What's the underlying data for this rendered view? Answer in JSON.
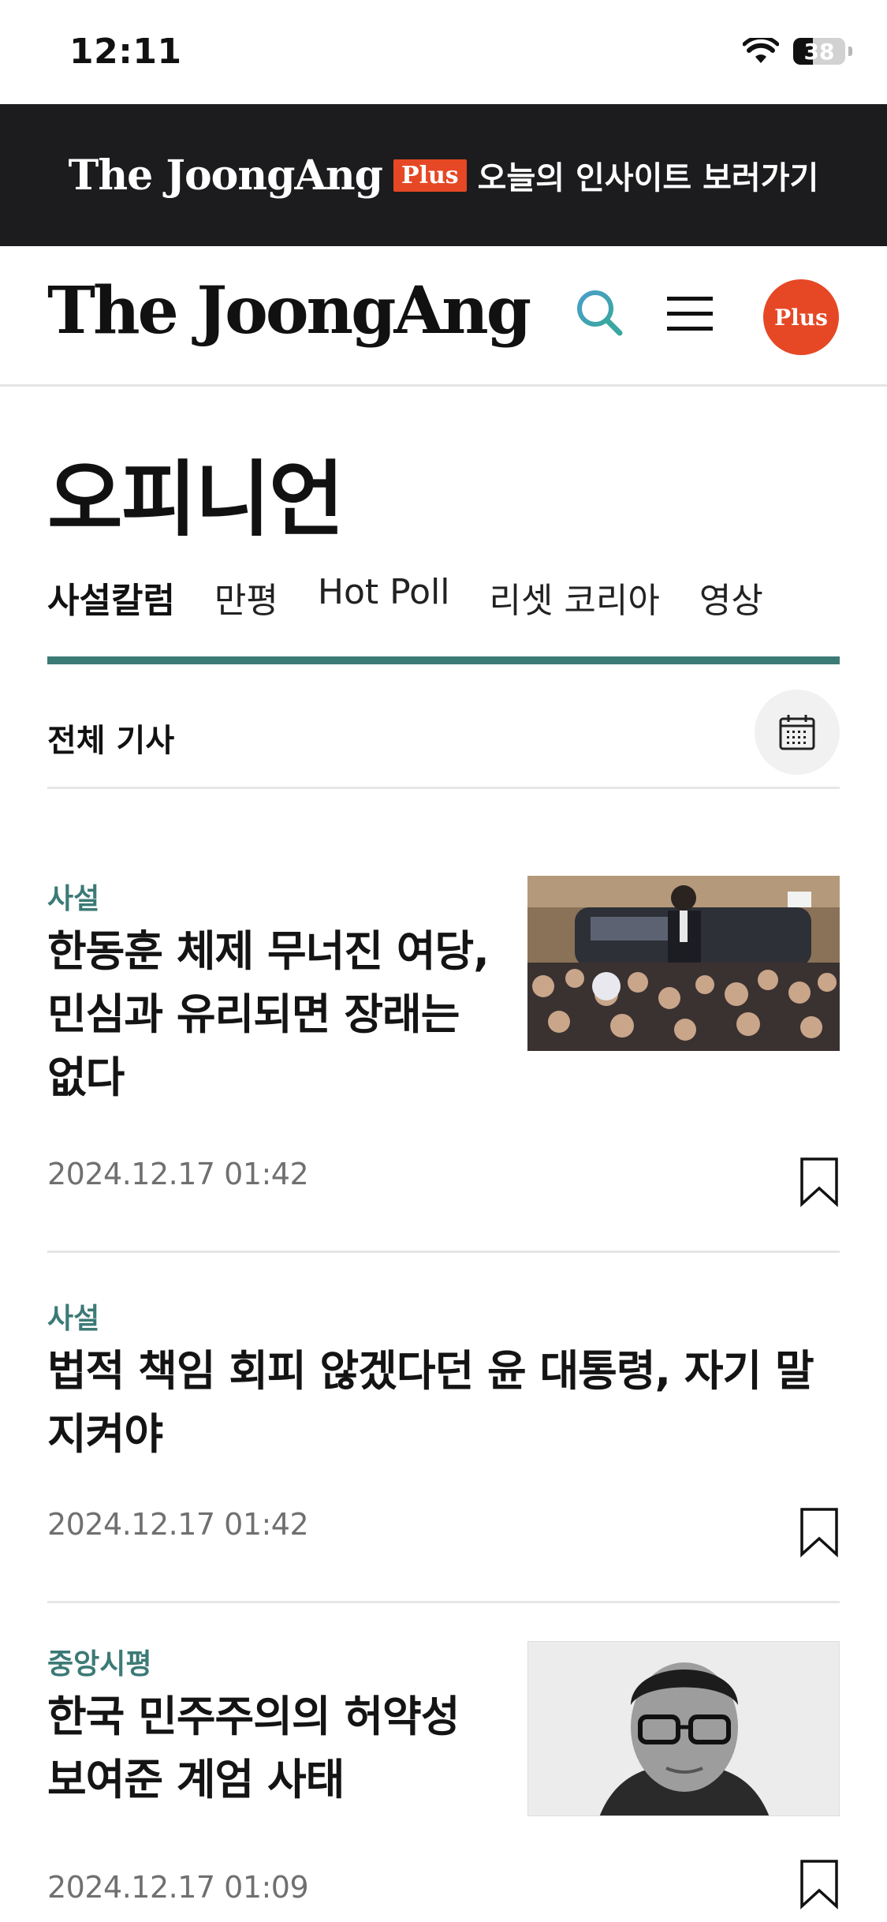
{
  "status_bar": {
    "time": "12:11",
    "battery": "38",
    "battery_level": 0.38
  },
  "promo_banner": {
    "brand": "The JoongAng",
    "badge": "Plus",
    "text": "오늘의 인사이트 보러가기"
  },
  "header": {
    "logo": "The JoongAng",
    "plus_button": "Plus"
  },
  "page": {
    "title": "오피니언",
    "tabs": [
      {
        "label": "사설칼럼",
        "active": true
      },
      {
        "label": "만평",
        "active": false
      },
      {
        "label": "Hot Poll",
        "active": false
      },
      {
        "label": "리셋 코리아",
        "active": false
      },
      {
        "label": "영상",
        "active": false
      }
    ],
    "section_label": "전체 기사"
  },
  "articles": [
    {
      "category": "사설",
      "title": "한동훈 체제 무너진 여당, 민심과 유리되면 장래는 없다",
      "date": "2024.12.17 01:42",
      "has_thumbnail": true
    },
    {
      "category": "사설",
      "title": "법적 책임 회피 않겠다던 윤 대통령, 자기 말 지켜야",
      "date": "2024.12.17 01:42",
      "has_thumbnail": false
    },
    {
      "category": "중앙시평",
      "title": "한국 민주주의의 허약성 보여준 계엄 사태",
      "date": "2024.12.17 01:09",
      "has_thumbnail": true
    }
  ],
  "colors": {
    "accent": "#3c7a76",
    "plus": "#e64825",
    "banner": "#1c1c1e"
  }
}
